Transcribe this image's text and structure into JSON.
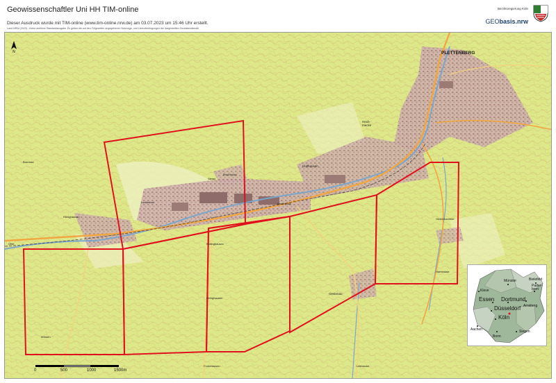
{
  "header": {
    "title": "Geowissenschaftler Uni HH TIM-online",
    "print_note": "Dieser Ausdruck wurde mit TIM-online (www.tim-online.nrw.de) am 03.07.2023 um 15:46 Uhr erstellt.",
    "license_note": "Land NRW (2023) - Keine amtliche Standardausgabe. Es gelten die auf den Folgeseiten angegebenen Nutzungs- und Lizenzbedingungen der dargestellten Geodatendienste"
  },
  "logo": {
    "agency": "Bezirksregierung Köln",
    "brand_prefix": "GEO",
    "brand_suffix": "basis.nrw",
    "crest_icon": "nrw-coat-of-arms-icon"
  },
  "map": {
    "colors": {
      "forest": "#dde889",
      "settlement": "#c8a6a2",
      "road": "#f1a640",
      "river": "#7aa6cc",
      "boundary": "#e0101c",
      "contour": "#c79b6b"
    },
    "place_labels": {
      "plettenberg": "PLETTENBERG",
      "holthausen": "Holthausen",
      "hechmecke": "Hech-\nmecke",
      "oesterhammer": "Oesterhammer",
      "oestenau": "Oestenau",
      "hunighausen": "Hünighausen",
      "landeman": "Landeman",
      "lettmecke": "Lettmecke",
      "kollinghausen": "Köllinghausen",
      "frohnhausen": "Frohnhausen",
      "eiringhausen": "Eiringhausen",
      "brachtroda": "Brachtroda",
      "bremcke": "Bremcke",
      "ohle": "Ohle",
      "wusten": "Wüsten",
      "siesel": "Siesel",
      "kersmecke": "Kersmecke",
      "hamerdale": "Hamerdale"
    },
    "north_arrow_icon": "north-arrow-icon",
    "scale": {
      "ticks": [
        "0",
        "500",
        "1000",
        "1500m"
      ]
    },
    "inset_map": {
      "cities": [
        {
          "name": "Kleve"
        },
        {
          "name": "Münster"
        },
        {
          "name": "Bielefeld"
        },
        {
          "name": "Pader-\nborn"
        },
        {
          "name": "Essen"
        },
        {
          "name": "Dortmund"
        },
        {
          "name": "Arnsberg"
        },
        {
          "name": "Düsseldorf"
        },
        {
          "name": "Köln"
        },
        {
          "name": "Aachen"
        },
        {
          "name": "Siegen"
        },
        {
          "name": "Bonn"
        }
      ]
    }
  }
}
